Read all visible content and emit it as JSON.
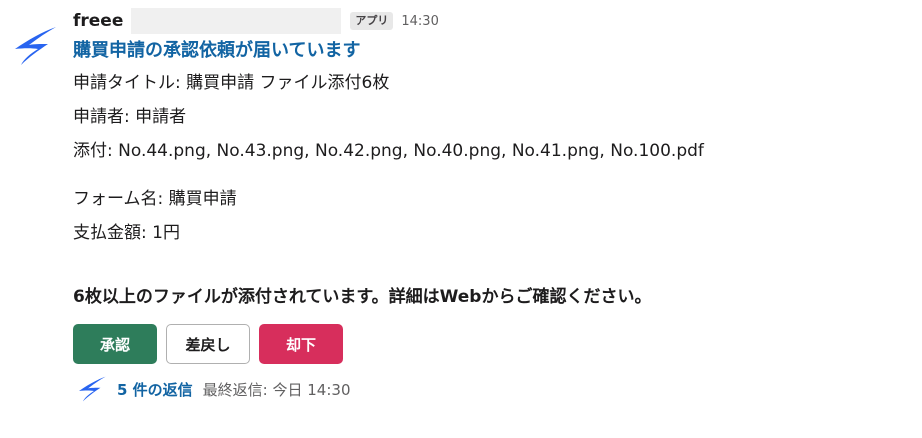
{
  "message": {
    "sender": "freee",
    "app_badge": "アプリ",
    "timestamp": "14:30",
    "title": "購買申請の承認依頼が届いています",
    "lines": [
      "申請タイトル: 購買申請 ファイル添付6枚",
      "申請者: 申請者",
      "添付: No.44.png, No.43.png, No.42.png, No.40.png, No.41.png, No.100.pdf"
    ],
    "lines2": [
      "フォーム名: 購買申請",
      "支払金額: 1円"
    ],
    "notice": "6枚以上のファイルが添付されています。詳細はWebからご確認ください。"
  },
  "actions": {
    "approve_label": "承認",
    "return_label": "差戻し",
    "reject_label": "却下"
  },
  "thread": {
    "reply_count": "5 件の返信",
    "last_reply": "最終返信: 今日 14:30"
  },
  "icons": {
    "avatar": "freee-bird-icon",
    "thread_avatar": "freee-bird-icon"
  },
  "colors": {
    "brand_blue": "#2864f0",
    "link": "#1264a3",
    "approve": "#2e7d5b",
    "reject": "#d72e5c"
  }
}
